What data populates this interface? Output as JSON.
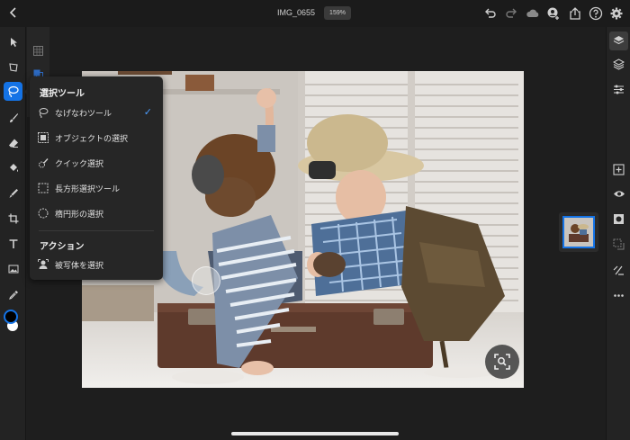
{
  "topbar": {
    "document_title": "IMG_0655",
    "zoom_level": "159%"
  },
  "selection_menu": {
    "section_title": "選択ツール",
    "items": [
      {
        "label": "なげなわツール",
        "icon": "lasso-icon",
        "selected": true
      },
      {
        "label": "オブジェクトの選択",
        "icon": "object-select-icon",
        "selected": false
      },
      {
        "label": "クイック選択",
        "icon": "quick-select-icon",
        "selected": false
      },
      {
        "label": "長方形選択ツール",
        "icon": "rect-marquee-icon",
        "selected": false
      },
      {
        "label": "楕円形の選択",
        "icon": "ellipse-marquee-icon",
        "selected": false
      }
    ],
    "actions_title": "アクション",
    "actions": [
      {
        "label": "被写体を選択",
        "icon": "select-subject-icon"
      }
    ]
  },
  "left_tools": [
    "move-tool-icon",
    "transform-tool-icon",
    "lasso-tool-icon",
    "brush-tool-icon",
    "eraser-tool-icon",
    "fill-tool-icon",
    "healing-tool-icon",
    "crop-tool-icon",
    "type-tool-icon",
    "image-tool-icon",
    "eyedropper-tool-icon"
  ],
  "right_tools": [
    "layers-icon",
    "layer-properties-icon",
    "adjustments-icon",
    "add-layer-icon",
    "visibility-icon",
    "mask-icon",
    "clip-icon",
    "fx-icon",
    "more-icon"
  ],
  "colors": {
    "accent": "#1473e6",
    "foreground_color": "#000000",
    "background_color": "#ffffff"
  }
}
